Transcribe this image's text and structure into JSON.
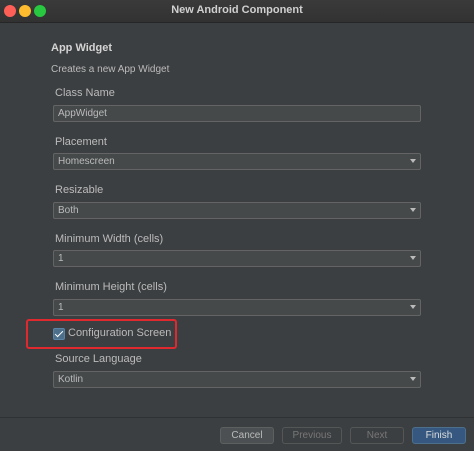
{
  "window": {
    "title": "New Android Component"
  },
  "header": {
    "title": "App Widget",
    "subtitle": "Creates a new App Widget"
  },
  "form": {
    "class_name": {
      "label": "Class Name",
      "value": "AppWidget"
    },
    "placement": {
      "label": "Placement",
      "value": "Homescreen"
    },
    "resizable": {
      "label": "Resizable",
      "value": "Both"
    },
    "min_width": {
      "label": "Minimum Width (cells)",
      "value": "1"
    },
    "min_height": {
      "label": "Minimum Height (cells)",
      "value": "1"
    },
    "configuration_screen": {
      "label": "Configuration Screen",
      "checked": true
    },
    "source_language": {
      "label": "Source Language",
      "value": "Kotlin"
    }
  },
  "footer": {
    "cancel": "Cancel",
    "previous": "Previous",
    "next": "Next",
    "finish": "Finish"
  },
  "colors": {
    "highlight": "#e0282f",
    "primary_button": "#365880",
    "background": "#3c3f41"
  }
}
